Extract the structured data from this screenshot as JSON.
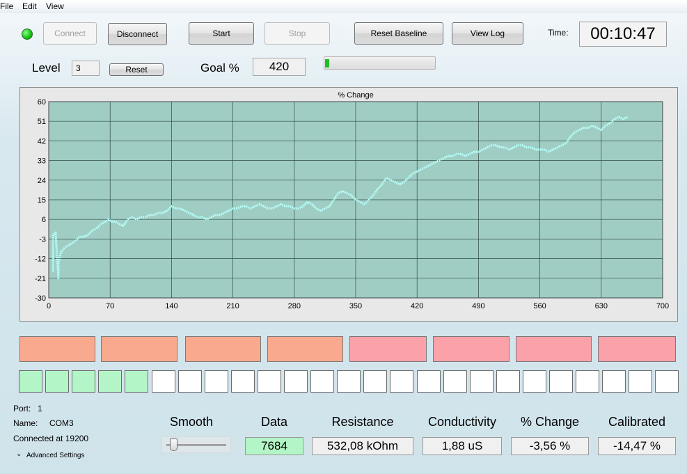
{
  "menu": {
    "file": "File",
    "edit": "Edit",
    "view": "View"
  },
  "toolbar": {
    "connect": "Connect",
    "disconnect": "Disconnect",
    "start": "Start",
    "stop": "Stop",
    "reset_baseline": "Reset Baseline",
    "view_log": "View Log",
    "time_label": "Time:",
    "time_value": "00:10:47",
    "status_led_color": "#12c012"
  },
  "level": {
    "label": "Level",
    "value": "3",
    "reset": "Reset"
  },
  "goal": {
    "label": "Goal %",
    "value": "420",
    "progress_fraction": 0.03
  },
  "chart_data": {
    "type": "line",
    "title": "% Change",
    "xlabel": "",
    "ylabel": "",
    "xlim": [
      0,
      700
    ],
    "ylim": [
      -30,
      60
    ],
    "xticks": [
      "0",
      "70",
      "140",
      "210",
      "280",
      "350",
      "420",
      "490",
      "560",
      "630",
      "700"
    ],
    "yticks": [
      "60",
      "51",
      "42",
      "33",
      "24",
      "15",
      "6",
      "-3",
      "-12",
      "-21",
      "-30"
    ],
    "grid": true,
    "series": [
      {
        "color": "#b6fffa",
        "x": [
          5,
          5,
          8,
          8,
          11,
          11,
          14,
          18,
          22,
          26,
          30,
          35,
          40,
          45,
          50,
          55,
          60,
          65,
          68,
          72,
          76,
          80,
          85,
          90,
          95,
          100,
          105,
          110,
          115,
          120,
          125,
          130,
          135,
          140,
          145,
          150,
          155,
          160,
          165,
          170,
          175,
          180,
          185,
          190,
          195,
          200,
          205,
          210,
          215,
          220,
          225,
          230,
          235,
          240,
          245,
          250,
          255,
          260,
          265,
          270,
          275,
          280,
          285,
          290,
          295,
          300,
          305,
          310,
          315,
          320,
          325,
          330,
          335,
          340,
          345,
          350,
          355,
          360,
          365,
          370,
          375,
          380,
          385,
          390,
          395,
          400,
          405,
          410,
          415,
          420,
          425,
          430,
          435,
          440,
          445,
          450,
          455,
          460,
          465,
          470,
          475,
          480,
          485,
          490,
          495,
          500,
          505,
          510,
          515,
          520,
          525,
          530,
          535,
          540,
          545,
          550,
          555,
          560,
          565,
          570,
          575,
          580,
          585,
          590,
          595,
          600,
          605,
          610,
          615,
          620,
          625,
          630,
          635,
          640,
          645,
          650,
          655,
          660
        ],
        "y": [
          -18,
          -1,
          0,
          -1,
          -21,
          -14,
          -9,
          -7,
          -6,
          -5,
          -4,
          -2,
          -2,
          -1,
          1,
          2,
          4,
          5,
          6,
          5,
          5,
          4,
          3,
          6,
          7,
          6,
          7,
          7,
          8,
          8,
          9,
          9,
          10,
          12,
          11,
          11,
          10,
          9,
          8,
          7,
          7,
          6,
          7,
          8,
          8,
          9,
          10,
          11,
          11,
          12,
          12,
          11,
          12,
          13,
          12,
          11,
          11,
          12,
          13,
          12,
          12,
          11,
          11,
          12,
          14,
          13,
          11,
          10,
          11,
          12,
          15,
          18,
          19,
          18,
          17,
          15,
          14,
          13,
          15,
          17,
          20,
          22,
          25,
          24,
          23,
          22,
          23,
          25,
          27,
          28,
          29,
          30,
          31,
          32,
          33,
          34,
          35,
          35,
          36,
          36,
          35,
          36,
          37,
          37,
          38,
          39,
          40,
          40,
          39,
          39,
          38,
          39,
          40,
          40,
          39,
          39,
          38,
          38,
          38,
          37,
          38,
          39,
          40,
          41,
          44,
          46,
          47,
          48,
          48,
          49,
          48,
          47,
          49,
          50,
          52,
          53,
          52,
          53
        ]
      }
    ]
  },
  "indicators": {
    "big": [
      "#f9a98e",
      "#f9a98e",
      "#f9a98e",
      "#f9a98e",
      "#fba1aa",
      "#fba1aa",
      "#fba1aa",
      "#fba1aa"
    ],
    "small_on_count": 5,
    "small_total": 25,
    "small_on_color": "#b3f5c6",
    "small_off_color": "#ffffff"
  },
  "port": {
    "port_label": "Port:",
    "port_value": "1",
    "name_label": "Name:",
    "name_value": "COM3",
    "connected": "Connected at 19200",
    "advanced": "Advanced Settings"
  },
  "readouts": {
    "smooth": "Smooth",
    "data_label": "Data",
    "data_value": "7684",
    "resistance_label": "Resistance",
    "resistance_value": "532,08 kOhm",
    "conductivity_label": "Conductivity",
    "conductivity_value": "1,88 uS",
    "change_label": "% Change",
    "change_value": "-3,56 %",
    "calibrated_label": "Calibrated",
    "calibrated_value": "-14,47 %",
    "smooth_level": 0.05
  }
}
